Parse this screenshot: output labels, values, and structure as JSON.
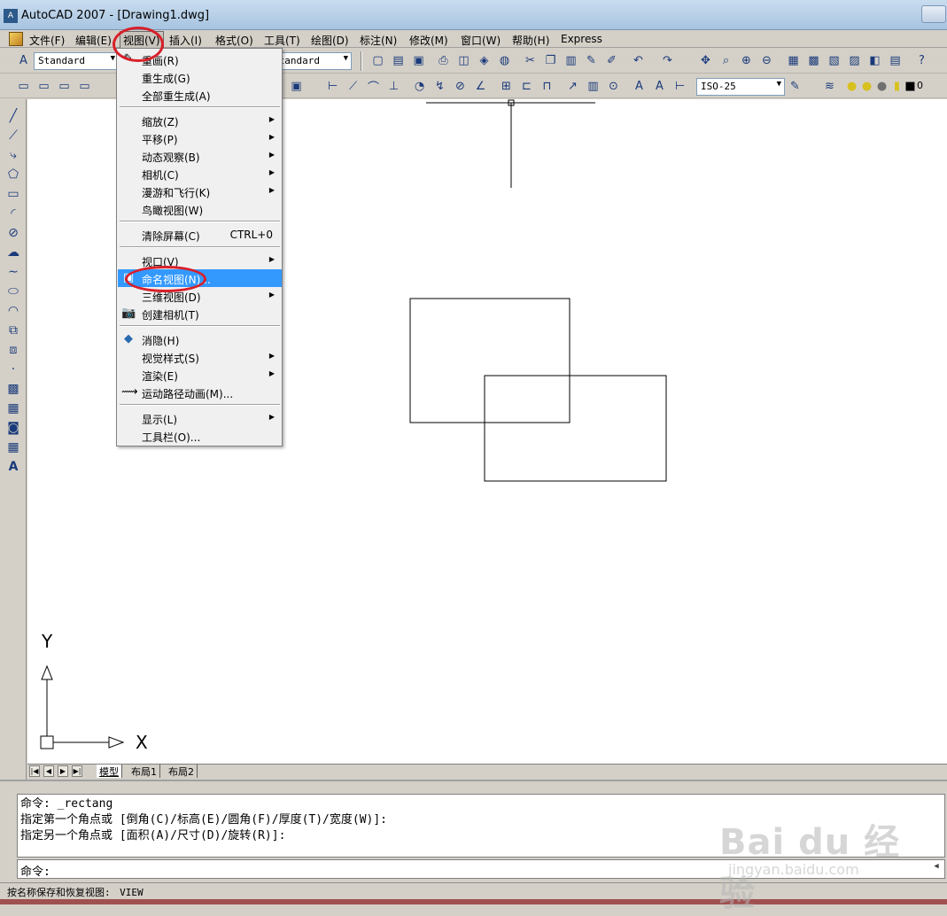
{
  "window": {
    "title": "AutoCAD 2007 - [Drawing1.dwg]",
    "app_icon": "autocad-logo-icon"
  },
  "menubar": {
    "items": [
      "文件(F)",
      "编辑(E)",
      "视图(V)",
      "插入(I)",
      "格式(O)",
      "工具(T)",
      "绘图(D)",
      "标注(N)",
      "修改(M)",
      "窗口(W)",
      "帮助(H)",
      "Express"
    ],
    "active_index": 2
  },
  "toolbar1": {
    "text_style": "Standard",
    "dim_style": "Standard"
  },
  "toolbar2": {
    "dim_style_combo": "ISO-25",
    "layer": "0"
  },
  "view_menu": {
    "items": [
      {
        "label": "重画(R)"
      },
      {
        "label": "重生成(G)"
      },
      {
        "label": "全部重生成(A)"
      },
      {
        "label": "缩放(Z)",
        "submenu": true
      },
      {
        "label": "平移(P)",
        "submenu": true
      },
      {
        "label": "动态观察(B)",
        "submenu": true
      },
      {
        "label": "相机(C)",
        "submenu": true
      },
      {
        "label": "漫游和飞行(K)",
        "submenu": true
      },
      {
        "label": "鸟瞰视图(W)"
      },
      {
        "label": "清除屏幕(C)",
        "shortcut": "CTRL+0"
      },
      {
        "label": "视口(V)",
        "submenu": true
      },
      {
        "label": "命名视图(N)...",
        "highlighted": true
      },
      {
        "label": "三维视图(D)",
        "submenu": true
      },
      {
        "label": "创建相机(T)"
      },
      {
        "label": "消隐(H)"
      },
      {
        "label": "视觉样式(S)",
        "submenu": true
      },
      {
        "label": "渲染(E)",
        "submenu": true
      },
      {
        "label": "运动路径动画(M)..."
      },
      {
        "label": "显示(L)",
        "submenu": true
      },
      {
        "label": "工具栏(O)..."
      }
    ]
  },
  "layout_tabs": [
    "模型",
    "布局1",
    "布局2"
  ],
  "ucs": {
    "x_label": "X",
    "y_label": "Y"
  },
  "command_window": {
    "history": [
      "命令: _rectang",
      "指定第一个角点或 [倒角(C)/标高(E)/圆角(F)/厚度(T)/宽度(W)]:",
      "指定另一个角点或 [面积(A)/尺寸(D)/旋转(R)]:"
    ],
    "prompt": "命令:"
  },
  "status_bar": {
    "help_text": "按名称保存和恢复视图:",
    "command": "VIEW"
  },
  "watermark": {
    "brand": "Bai du 经验",
    "url": "jingyan.baidu.com"
  },
  "colors": {
    "highlight": "#3399ff",
    "annotation_ring": "#d8202a"
  }
}
